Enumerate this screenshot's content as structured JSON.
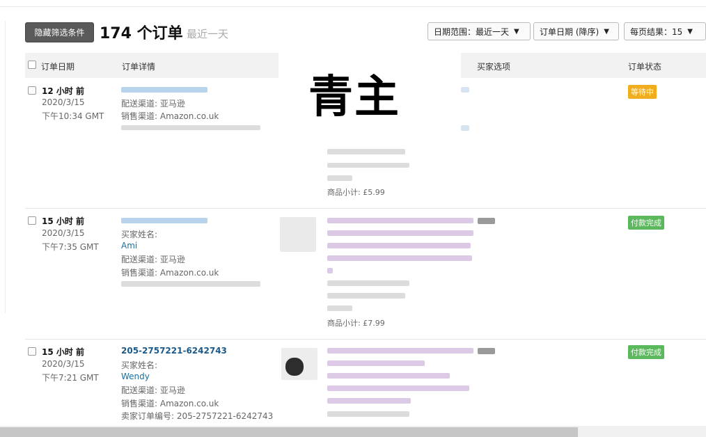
{
  "toolbar": {
    "hide_filters_label": "隐藏筛选条件",
    "order_count": "174 个订单",
    "order_range": "最近一天"
  },
  "selects": {
    "date_range": "日期范围：最近一天",
    "sort": "订单日期 (降序)",
    "per_page": "每页结果：15"
  },
  "columns": {
    "date": "订单日期",
    "details": "订单详情",
    "buyer_options": "买家选项",
    "status": "订单状态"
  },
  "overlay_text": "青主",
  "orders": [
    {
      "age": "12 小时 前",
      "date": "2020/3/15",
      "time": "下午10:34 GMT",
      "ship_label": "配送渠道: 亚马逊",
      "sales_label": "销售渠道: Amazon.co.uk",
      "subtotal": "商品小计: £5.99",
      "status": "等待中"
    },
    {
      "age": "15 小时 前",
      "date": "2020/3/15",
      "time": "下午7:35 GMT",
      "buyer_label": "买家姓名:",
      "buyer_name": "Ami",
      "ship_label": "配送渠道: 亚马逊",
      "sales_label": "销售渠道: Amazon.co.uk",
      "subtotal": "商品小计: £7.99",
      "status": "付款完成"
    },
    {
      "age": "15 小时 前",
      "date": "2020/3/15",
      "time": "下午7:21 GMT",
      "order_id": "205-2757221-6242743",
      "buyer_label": "买家姓名:",
      "buyer_name": "Wendy",
      "ship_label": "配送渠道: 亚马逊",
      "sales_label": "销售渠道: Amazon.co.uk",
      "seller_order": "卖家订单编号: 205-2757221-6242743",
      "status": "付款完成"
    }
  ],
  "colors": {
    "pending": "#f0ad1e",
    "paid": "#5cb85c",
    "link": "#1a6e9e"
  }
}
